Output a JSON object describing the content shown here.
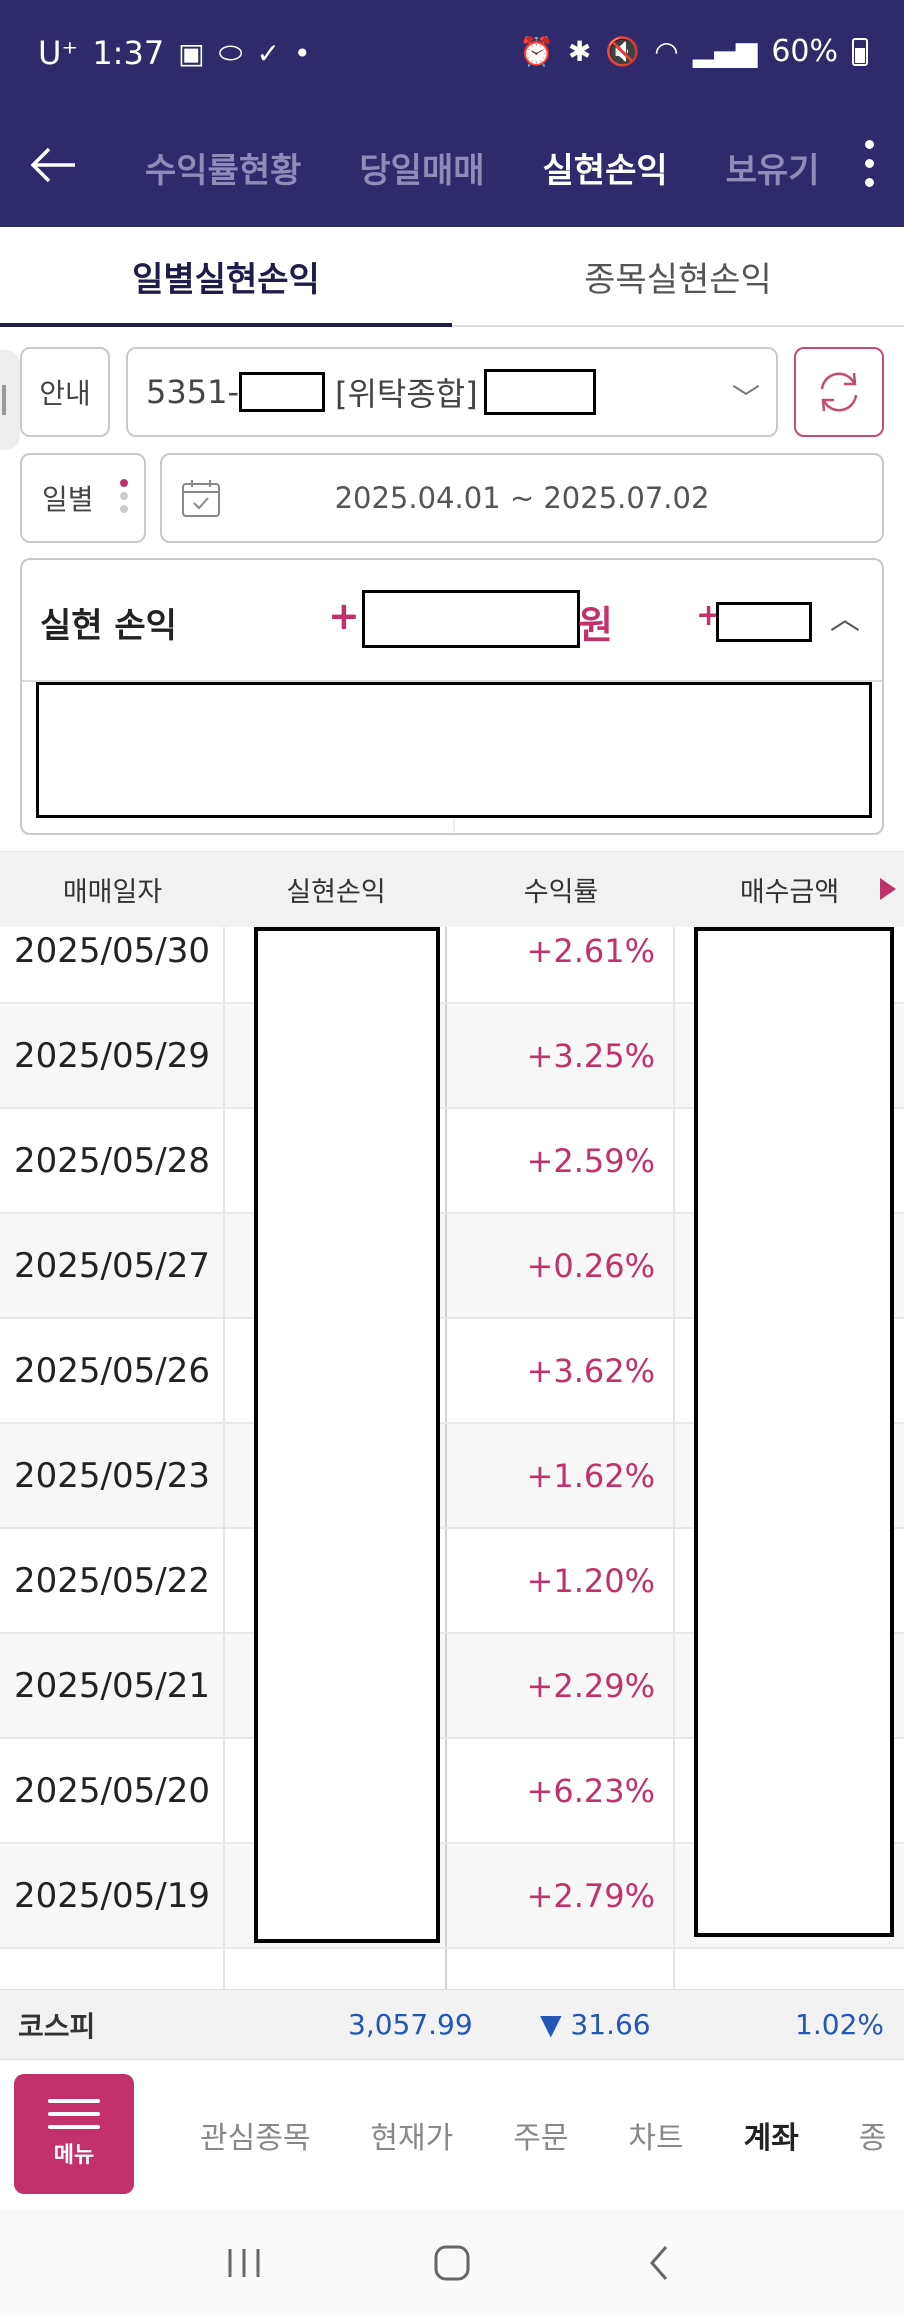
{
  "status_bar": {
    "carrier": "U⁺",
    "time": "1:37",
    "battery": "60%"
  },
  "nav": {
    "tabs": [
      "수익률현황",
      "당일매매",
      "실현손익",
      "보유기"
    ],
    "active_index": 2
  },
  "sub_tabs": [
    "일별실현손익",
    "종목실현손익"
  ],
  "account": {
    "info_label": "안내",
    "number_prefix": "5351-",
    "type": "[위탁종합]"
  },
  "period": {
    "label": "일별",
    "range": "2025.04.01 ~ 2025.07.02"
  },
  "summary": {
    "label": "실현 손익",
    "sign": "+",
    "unit": "원",
    "sign2": "+"
  },
  "table": {
    "headers": [
      "매매일자",
      "실현손익",
      "수익률",
      "매수금액"
    ],
    "rows": [
      {
        "date": "2025/05/30",
        "rate": "+2.61%"
      },
      {
        "date": "2025/05/29",
        "rate": "+3.25%"
      },
      {
        "date": "2025/05/28",
        "rate": "+2.59%"
      },
      {
        "date": "2025/05/27",
        "rate": "+0.26%"
      },
      {
        "date": "2025/05/26",
        "rate": "+3.62%"
      },
      {
        "date": "2025/05/23",
        "rate": "+1.62%"
      },
      {
        "date": "2025/05/22",
        "rate": "+1.20%"
      },
      {
        "date": "2025/05/21",
        "rate": "+2.29%"
      },
      {
        "date": "2025/05/20",
        "rate": "+6.23%"
      },
      {
        "date": "2025/05/19",
        "rate": "+2.79%"
      }
    ]
  },
  "index": {
    "name": "코스피",
    "value": "3,057.99",
    "change": "▼ 31.66",
    "percent": "1.02%"
  },
  "bottom_menu": {
    "menu_label": "메뉴",
    "items": [
      "관심종목",
      "현재가",
      "주문",
      "차트",
      "계좌",
      "종"
    ],
    "active_index": 4
  },
  "colors": {
    "header_bg": "#2e2a6b",
    "accent": "#c3316b",
    "index_blue": "#2356b8"
  }
}
